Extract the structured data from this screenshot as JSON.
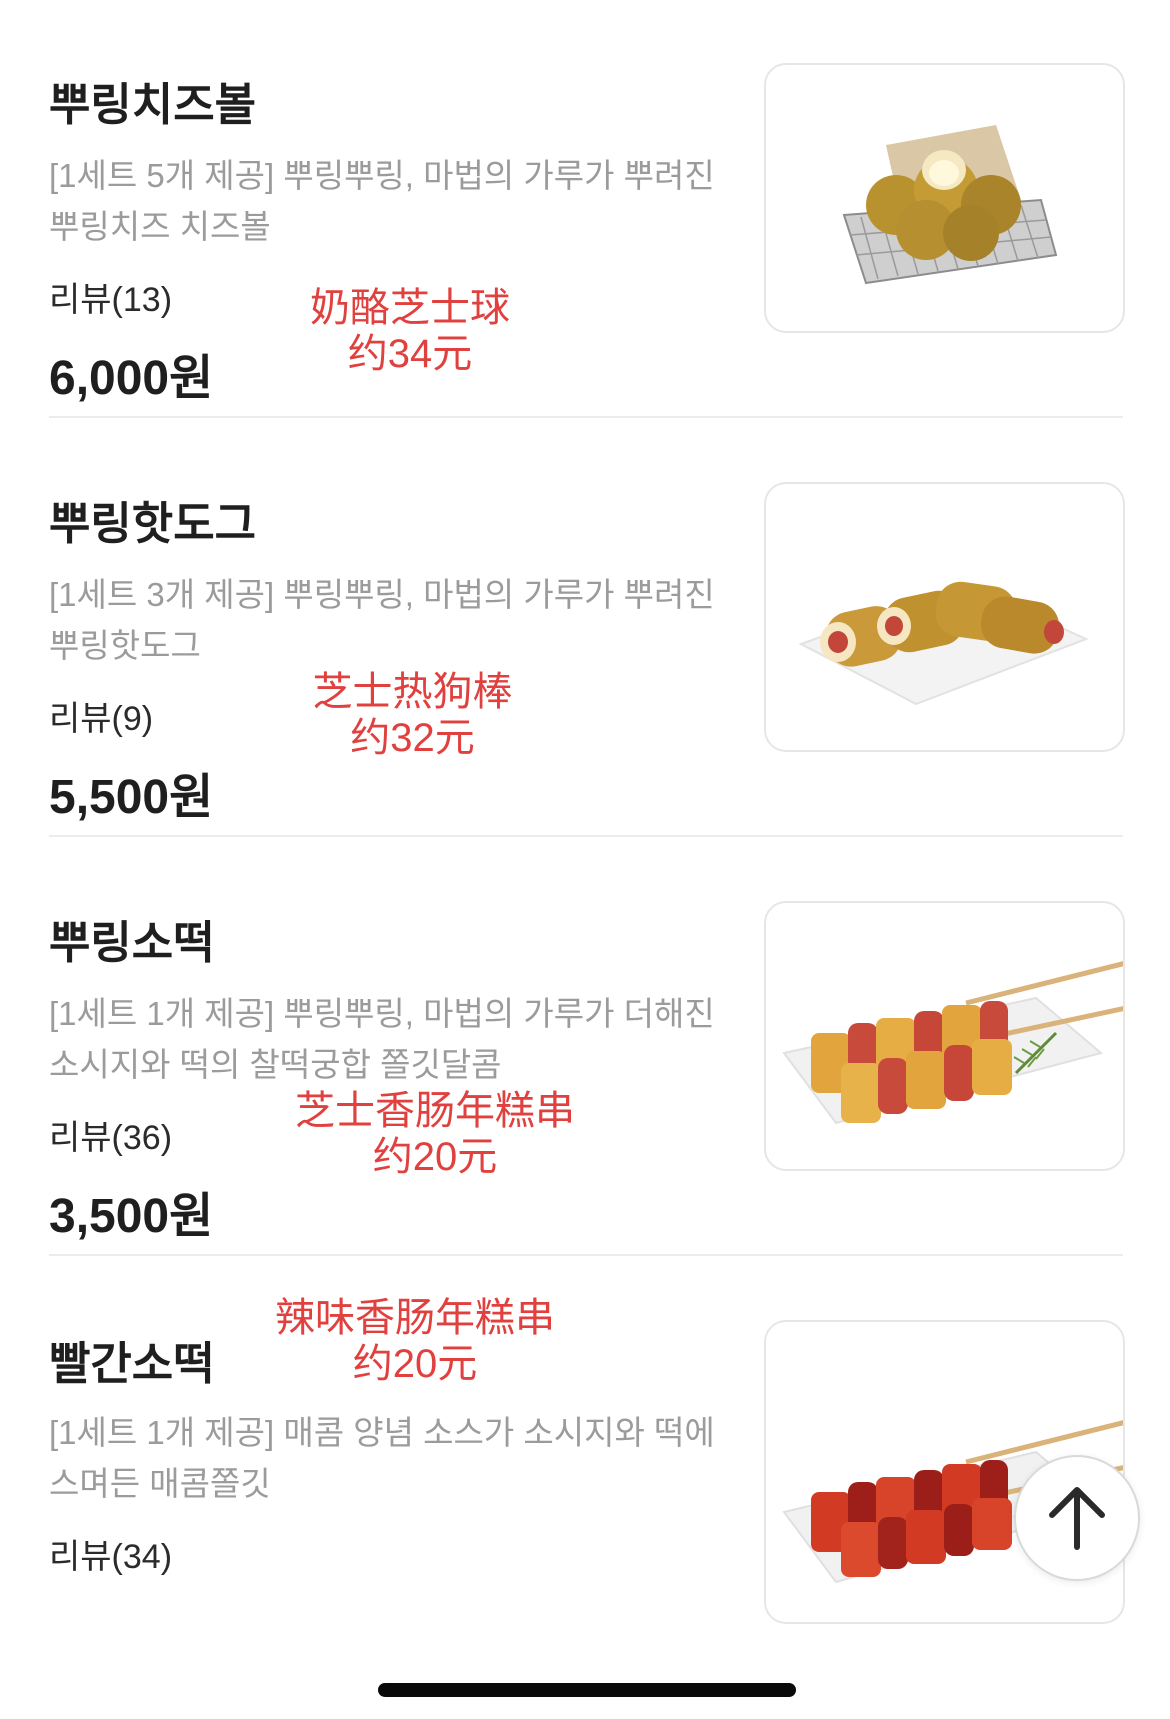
{
  "items": [
    {
      "name": "뿌링치즈볼",
      "description": "[1세트 5개 제공] 뿌링뿌링, 마법의 가루가 뿌려진 뿌링치즈 치즈볼",
      "reviews": "리뷰(13)",
      "price": "6,000원",
      "annotation_line1": "奶酪芝士球",
      "annotation_line2": "约34元"
    },
    {
      "name": "뿌링핫도그",
      "description": "[1세트 3개 제공] 뿌링뿌링, 마법의 가루가 뿌려진 뿌링핫도그",
      "reviews": "리뷰(9)",
      "price": "5,500원",
      "annotation_line1": "芝士热狗棒",
      "annotation_line2": "约32元"
    },
    {
      "name": "뿌링소떡",
      "description": "[1세트 1개 제공] 뿌링뿌링, 마법의 가루가 더해진 소시지와 떡의 찰떡궁합 쫄깃달콤",
      "reviews": "리뷰(36)",
      "price": "3,500원",
      "annotation_line1": "芝士香肠年糕串",
      "annotation_line2": "约20元"
    },
    {
      "name": "빨간소떡",
      "description": "[1세트 1개 제공] 매콤 양념 소스가 소시지와 떡에 스며든 매콤쫄깃",
      "reviews": "리뷰(34)",
      "price": "",
      "annotation_line1": "辣味香肠年糕串",
      "annotation_line2": "约20元"
    }
  ],
  "icons": {
    "scroll_top": "arrow-up-icon"
  },
  "colors": {
    "annotation": "#e0403e",
    "description": "#9b9b9b",
    "title": "#1f1f1f"
  }
}
